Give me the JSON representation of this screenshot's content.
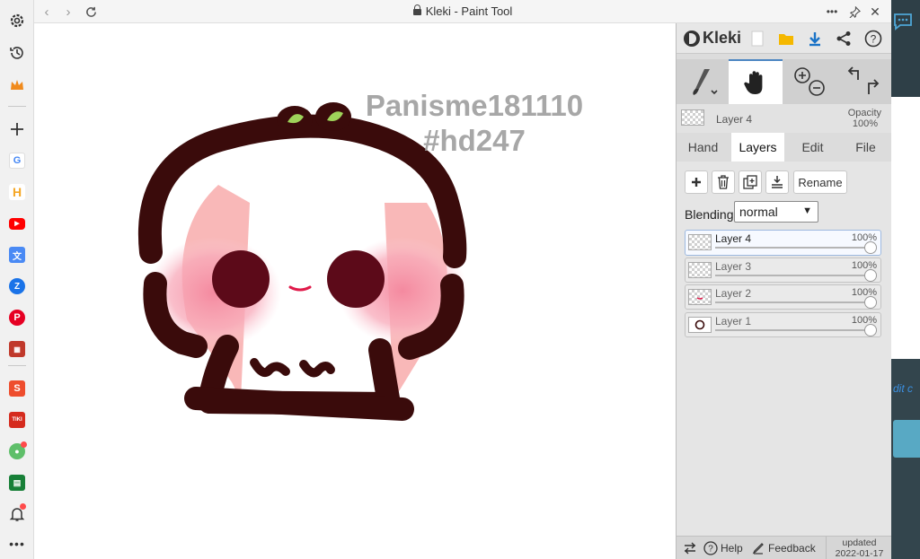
{
  "browser": {
    "title": "Kleki - Paint Tool",
    "sidebar_icons": [
      "settings-icon",
      "history-icon",
      "crown-icon",
      "add-icon",
      "google-icon",
      "hh-icon",
      "youtube-icon",
      "translate-icon",
      "zalo-icon",
      "pinterest-icon",
      "cambridge-icon",
      "shopee-tet-icon",
      "tiki-tet-icon",
      "extension-icon",
      "sheets-icon",
      "notifications-icon",
      "more-icon"
    ],
    "tiki_label": "TIKI"
  },
  "app": {
    "brand": "Kleki",
    "current_layer": "Layer 4",
    "opacity_label": "Opacity",
    "opacity_value": "100%",
    "tabs": [
      {
        "label": "Hand",
        "active": false
      },
      {
        "label": "Layers",
        "active": true
      },
      {
        "label": "Edit",
        "active": false
      },
      {
        "label": "File",
        "active": false
      }
    ],
    "rename_label": "Rename",
    "blending_label": "Blending",
    "blending_value": "normal",
    "layers": [
      {
        "name": "Layer 4",
        "opacity": "100%",
        "opacity_fraction": 1.0,
        "active": true
      },
      {
        "name": "Layer 3",
        "opacity": "100%",
        "opacity_fraction": 1.0,
        "active": false
      },
      {
        "name": "Layer 2",
        "opacity": "100%",
        "opacity_fraction": 1.0,
        "active": false
      },
      {
        "name": "Layer 1",
        "opacity": "100%",
        "opacity_fraction": 1.0,
        "active": false
      }
    ],
    "bottom": {
      "help": "Help",
      "feedback": "Feedback",
      "updated_label": "updated",
      "updated_date": "2022-01-17"
    }
  },
  "canvas": {
    "watermark_line1": "Panisme181110",
    "watermark_line2": "#hd247"
  },
  "background_page": {
    "partial_text": "dit c"
  },
  "colors": {
    "accent": "#1a73c7",
    "outline": "#3a0b0b",
    "blush": "#f7a8b8",
    "leaf": "#9fd35a"
  }
}
